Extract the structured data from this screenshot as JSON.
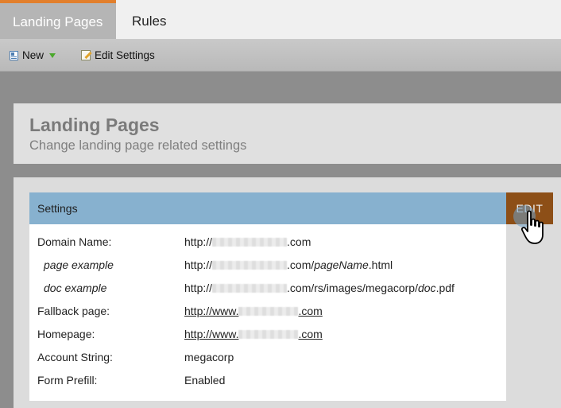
{
  "tabs": [
    {
      "label": "Landing Pages",
      "active": true
    },
    {
      "label": "Rules",
      "active": false
    }
  ],
  "toolbar": {
    "new_label": "New",
    "edit_settings_label": "Edit Settings"
  },
  "header": {
    "title": "Landing Pages",
    "subtitle": "Change landing page related settings"
  },
  "settings": {
    "section_title": "Settings",
    "edit_label": "EDIT",
    "rows": [
      {
        "label": "Domain Name:",
        "prefix": "http://",
        "suffix": ".com"
      },
      {
        "label": "page example",
        "prefix": "http://",
        "suffix": ".com/",
        "italic_part": "pageName",
        "tail": ".html"
      },
      {
        "label": "doc example",
        "prefix": "http://",
        "suffix": ".com/rs/images/megacorp/",
        "italic_part": "doc",
        "tail": ".pdf"
      },
      {
        "label": "Fallback page:",
        "prefix": "http://www.",
        "suffix": ".com"
      },
      {
        "label": "Homepage:",
        "prefix": "http://www.",
        "suffix": ".com"
      },
      {
        "label": "Account String:",
        "value": "megacorp"
      },
      {
        "label": "Form Prefill:",
        "value": "Enabled"
      }
    ]
  },
  "colors": {
    "tab_accent": "#e27f2c",
    "section_bar": "#87b1cf",
    "edit_button": "#8d4f17"
  },
  "icons": [
    "new-icon",
    "dropdown-caret-icon",
    "edit-settings-icon",
    "hand-pointer-icon"
  ]
}
